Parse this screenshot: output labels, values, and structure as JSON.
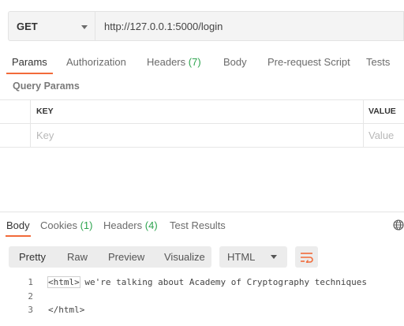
{
  "request": {
    "method": "GET",
    "url": "http://127.0.0.1:5000/login"
  },
  "request_tabs": [
    {
      "label": "Params",
      "count": ""
    },
    {
      "label": "Authorization",
      "count": ""
    },
    {
      "label": "Headers",
      "count": "(7)"
    },
    {
      "label": "Body",
      "count": ""
    },
    {
      "label": "Pre-request Script",
      "count": ""
    },
    {
      "label": "Tests",
      "count": ""
    }
  ],
  "query_params": {
    "title": "Query Params",
    "col_key": "KEY",
    "col_value": "VALUE",
    "key_placeholder": "Key",
    "value_placeholder": "Value"
  },
  "response_tabs": [
    {
      "label": "Body",
      "count": ""
    },
    {
      "label": "Cookies",
      "count": "(1)"
    },
    {
      "label": "Headers",
      "count": "(4)"
    },
    {
      "label": "Test Results",
      "count": ""
    }
  ],
  "response_views": [
    "Pretty",
    "Raw",
    "Preview",
    "Visualize"
  ],
  "response_format": "HTML",
  "code_lines": [
    {
      "num": "1",
      "open": "<html>",
      "text": " we're talking about Academy of Cryptography techniques"
    },
    {
      "num": "2",
      "open": "",
      "text": ""
    },
    {
      "num": "3",
      "open": "",
      "text": "</html>"
    }
  ],
  "colors": {
    "accent": "#f26b3a",
    "count": "#2ea44f"
  },
  "icons": [
    "caret-down-icon",
    "globe-icon",
    "wrap-lines-icon"
  ]
}
